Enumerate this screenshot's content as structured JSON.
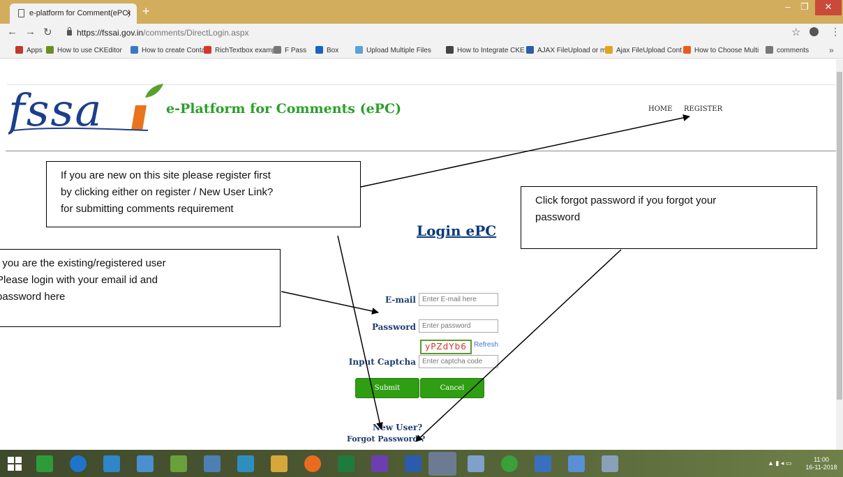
{
  "browser": {
    "tab_title": "e-platform for Comment(ePC)",
    "tab_close": "×",
    "new_tab": "+",
    "url_host": "https://fssai.gov.in",
    "url_path": "/comments/DirectLogin.aspx",
    "bookmarks": [
      {
        "label": "Apps",
        "color": "#c0392b"
      },
      {
        "label": "How to use CKEditor",
        "color": "#6b8e23"
      },
      {
        "label": "How to create Conta",
        "color": "#3a79c5"
      },
      {
        "label": "RichTextbox example",
        "color": "#d9362b"
      },
      {
        "label": "F Pass",
        "color": "#777777"
      },
      {
        "label": "Box",
        "color": "#1b62c6"
      },
      {
        "label": "Upload Multiple Files",
        "color": "#5aa2d8"
      },
      {
        "label": "How to Integrate CKE",
        "color": "#444444"
      },
      {
        "label": "AJAX FileUpload or m",
        "color": "#2a5ea8"
      },
      {
        "label": "Ajax FileUpload Cont",
        "color": "#e0a41e"
      },
      {
        "label": "How to Choose Multi",
        "color": "#e95b1e"
      },
      {
        "label": "comments",
        "color": "#777777"
      }
    ],
    "bookmarks_more": "»"
  },
  "site": {
    "logo_text": "fssai",
    "title": "e-Platform for Comments (ePC)",
    "nav_home": "HOME",
    "nav_register": "REGISTER"
  },
  "login": {
    "heading": "Login ePC",
    "email_label": "E-mail",
    "email_placeholder": "Enter E-mail here",
    "password_label": "Password",
    "password_placeholder": "Enter password",
    "captcha_text": "yPZdYb6",
    "refresh_label": "Refresh",
    "captcha_label": "Input Captcha",
    "captcha_placeholder": "Enter captcha code",
    "submit_label": "Submit",
    "cancel_label": "Cancel",
    "new_user_label": "New User?",
    "forgot_label": "Forgot Password ?"
  },
  "callouts": {
    "register_line1": "If you are new on this site please register  first",
    "register_line2": "by clicking either on register / New User Link?",
    "register_line3": "for submitting comments requirement",
    "existing_line1": "f you are the existing/registered  user",
    "existing_line2": "Please login with your email id and",
    "existing_line3": "password here",
    "forgot_line1": "Click forgot password if you forgot your",
    "forgot_line2": "password"
  },
  "taskbar": {
    "time": "11:00",
    "date": "16-11-2018"
  }
}
